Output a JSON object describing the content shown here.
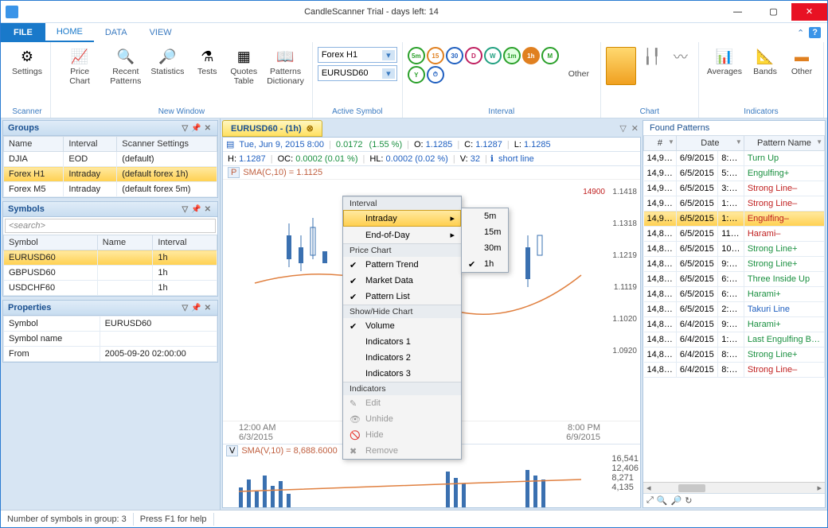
{
  "window": {
    "title": "CandleScanner Trial  -  days left: 14"
  },
  "tabs": {
    "file": "FILE",
    "items": [
      "HOME",
      "DATA",
      "VIEW"
    ],
    "active": 0
  },
  "ribbon": {
    "scanner": {
      "label": "Scanner",
      "settings": "Settings"
    },
    "newwindow": {
      "label": "New Window",
      "priceChart": "Price Chart",
      "recentPatterns": "Recent\nPatterns",
      "statistics": "Statistics",
      "tests": "Tests",
      "quotesTable": "Quotes\nTable",
      "patternsDict": "Patterns\nDictionary"
    },
    "activeSymbol": {
      "label": "Active Symbol",
      "group": "Forex H1",
      "symbol": "EURUSD60"
    },
    "interval": {
      "label": "Interval",
      "other": "Other"
    },
    "chart": {
      "label": "Chart"
    },
    "indicators": {
      "label": "Indicators",
      "averages": "Averages",
      "bands": "Bands",
      "other": "Other"
    }
  },
  "groups": {
    "title": "Groups",
    "columns": [
      "Name",
      "Interval",
      "Scanner Settings"
    ],
    "rows": [
      {
        "name": "DJIA",
        "interval": "EOD",
        "settings": "(default)"
      },
      {
        "name": "Forex H1",
        "interval": "Intraday",
        "settings": "(default forex 1h)",
        "sel": true
      },
      {
        "name": "Forex M5",
        "interval": "Intraday",
        "settings": "(default forex 5m)"
      }
    ]
  },
  "symbols": {
    "title": "Symbols",
    "search": "<search>",
    "columns": [
      "Symbol",
      "Name",
      "Interval"
    ],
    "rows": [
      {
        "symbol": "EURUSD60",
        "name": "",
        "interval": "1h",
        "sel": true
      },
      {
        "symbol": "GBPUSD60",
        "name": "",
        "interval": "1h"
      },
      {
        "symbol": "USDCHF60",
        "name": "",
        "interval": "1h"
      }
    ]
  },
  "properties": {
    "title": "Properties",
    "rows": [
      {
        "k": "Symbol",
        "v": "EURUSD60"
      },
      {
        "k": "Symbol name",
        "v": ""
      },
      {
        "k": "From",
        "v": "2005-09-20 02:00:00"
      }
    ]
  },
  "doc": {
    "tab": "EURUSD60 - (1h)"
  },
  "chartInfo": {
    "date": "Tue, Jun 9, 2015  8:00",
    "change": "0.0172",
    "changePct": "(1.55 %)",
    "O": "1.1285",
    "C": "1.1287",
    "L": "1.1285",
    "H": "1.1287",
    "OC": "0.0002",
    "OCPct": "(0.01 %)",
    "HL": "0.0002",
    "HLPct": "(0.02 %)",
    "V": "32",
    "pattern": "short line",
    "sma": "SMA(C,10) = 1.1125",
    "smaV": "SMA(V,10) = 8,688.6000"
  },
  "chartAxis": {
    "yticks": [
      "1.1418",
      "1.1318",
      "1.1219",
      "1.1119",
      "1.1020",
      "1.0920"
    ],
    "marker": "14900",
    "xtimes": [
      "12:00 AM",
      "8:00 PM"
    ],
    "xdates": [
      "6/3/2015",
      "6/9/2015"
    ],
    "volTicks": [
      "16,541",
      "12,406",
      "8,271",
      "4,135"
    ]
  },
  "ctx": {
    "sections": {
      "interval": "Interval",
      "priceChart": "Price Chart",
      "showHide": "Show/Hide Chart",
      "indicators": "Indicators"
    },
    "interval": {
      "intraday": "Intraday",
      "eod": "End-of-Day"
    },
    "sub": [
      "5m",
      "15m",
      "30m",
      "1h"
    ],
    "priceChart": [
      "Pattern Trend",
      "Market Data",
      "Pattern List"
    ],
    "showHide": [
      "Volume",
      "Indicators 1",
      "Indicators 2",
      "Indicators 3"
    ],
    "indicators": [
      "Edit",
      "Unhide",
      "Hide",
      "Remove"
    ]
  },
  "patterns": {
    "title": "Found Patterns",
    "columns": [
      "#",
      "Date",
      "Pattern Name"
    ],
    "rows": [
      {
        "n": "14,9…",
        "d": "6/9/2015",
        "t": "8:…",
        "p": "Turn Up",
        "c": "green"
      },
      {
        "n": "14,9…",
        "d": "6/5/2015",
        "t": "5:…",
        "p": "Engulfing+",
        "c": "green"
      },
      {
        "n": "14,9…",
        "d": "6/5/2015",
        "t": "3:…",
        "p": "Strong Line–",
        "c": "red"
      },
      {
        "n": "14,9…",
        "d": "6/5/2015",
        "t": "1:…",
        "p": "Strong Line–",
        "c": "red"
      },
      {
        "n": "14,9…",
        "d": "6/5/2015",
        "t": "1:…",
        "p": "Engulfing–",
        "c": "red",
        "sel": true
      },
      {
        "n": "14,8…",
        "d": "6/5/2015",
        "t": "11…",
        "p": "Harami–",
        "c": "red"
      },
      {
        "n": "14,8…",
        "d": "6/5/2015",
        "t": "10…",
        "p": "Strong Line+",
        "c": "green"
      },
      {
        "n": "14,8…",
        "d": "6/5/2015",
        "t": "9:…",
        "p": "Strong Line+",
        "c": "green"
      },
      {
        "n": "14,8…",
        "d": "6/5/2015",
        "t": "6:…",
        "p": "Three Inside Up",
        "c": "green"
      },
      {
        "n": "14,8…",
        "d": "6/5/2015",
        "t": "6:…",
        "p": "Harami+",
        "c": "green"
      },
      {
        "n": "14,8…",
        "d": "6/5/2015",
        "t": "2:…",
        "p": "Takuri Line",
        "c": "blue"
      },
      {
        "n": "14,8…",
        "d": "6/4/2015",
        "t": "9:…",
        "p": "Harami+",
        "c": "green"
      },
      {
        "n": "14,8…",
        "d": "6/4/2015",
        "t": "1:…",
        "p": "Last Engulfing B…",
        "c": "green"
      },
      {
        "n": "14,8…",
        "d": "6/4/2015",
        "t": "8:…",
        "p": "Strong Line+",
        "c": "green"
      },
      {
        "n": "14,8…",
        "d": "6/4/2015",
        "t": "8:…",
        "p": "Strong Line–",
        "c": "red"
      }
    ]
  },
  "status": {
    "left": "Number of symbols in group: 3",
    "right": "Press F1 for help"
  }
}
